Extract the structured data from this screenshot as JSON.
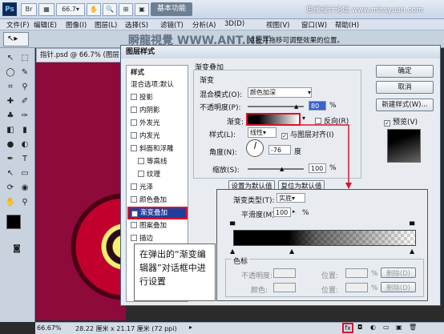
{
  "titlebar": {
    "app_logo": "Ps",
    "workspace_button": "基本功能",
    "watermark": "思缘设计论坛 www.missyuan.com",
    "zoom_value": "66.7"
  },
  "menubar": {
    "items": [
      "文件(F)",
      "编辑(E)",
      "图像(I)",
      "图层(L)",
      "选择(S)",
      "滤镜(T)",
      "分析(A)",
      "3D(D)",
      "视图(V)",
      "窗口(W)",
      "帮助(H)"
    ]
  },
  "optionsbar": {
    "hint": "点按并拖移可调整效果的位置。",
    "watermark": "瞬龍視覺 WWW.ANT.NET"
  },
  "document": {
    "tab_title": "指针.psd @ 66.7% (图层"
  },
  "statusbar": {
    "zoom": "66.67%",
    "doc_info": "28.22 厘米 x 21.17 厘米 (72 ppi)"
  },
  "dialog": {
    "title": "图层样式",
    "styles_header": "样式",
    "blend_options": "混合选项:默认",
    "styles": [
      {
        "label": "投影",
        "checked": false
      },
      {
        "label": "内阴影",
        "checked": false
      },
      {
        "label": "外发光",
        "checked": false
      },
      {
        "label": "内发光",
        "checked": false
      },
      {
        "label": "斜面和浮雕",
        "checked": false
      },
      {
        "label": "等高线",
        "checked": false
      },
      {
        "label": "纹理",
        "checked": false
      },
      {
        "label": "光泽",
        "checked": false
      },
      {
        "label": "颜色叠加",
        "checked": false
      },
      {
        "label": "渐变叠加",
        "checked": true
      },
      {
        "label": "图案叠加",
        "checked": false
      },
      {
        "label": "描边",
        "checked": false
      }
    ],
    "section_title": "渐变叠加",
    "subsection_title": "渐变",
    "blend_mode_label": "混合模式(O):",
    "blend_mode_value": "颜色加深",
    "opacity_label": "不透明度(P):",
    "opacity_value": "80",
    "percent": "%",
    "gradient_label": "渐变:",
    "reverse_label": "反向(R)",
    "style_label": "样式(L):",
    "style_value": "线性",
    "align_label": "与图层对齐(I)",
    "angle_label": "角度(N):",
    "angle_value": "-76",
    "degree": "度",
    "scale_label": "缩放(S):",
    "scale_value": "100",
    "make_default": "设置为默认值",
    "reset_default": "复位为默认值",
    "ok": "确定",
    "cancel": "取消",
    "new_style": "新建样式(W)...",
    "preview": "预览(V)"
  },
  "gradient_editor": {
    "type_label": "渐变类型(T):",
    "type_value": "实底",
    "smooth_label": "平滑度(M):",
    "smooth_value": "100",
    "percent": "%",
    "stops_title": "色标",
    "opacity_label": "不透明度:",
    "color_label": "颜色:",
    "position_label": "位置:",
    "delete": "删除(D)"
  },
  "callout": {
    "text": "在弹出的“渐变编辑器”对话框中进行设置"
  },
  "colors": {
    "highlight": "#e0102a",
    "selected_row": "#1f3f9c"
  }
}
